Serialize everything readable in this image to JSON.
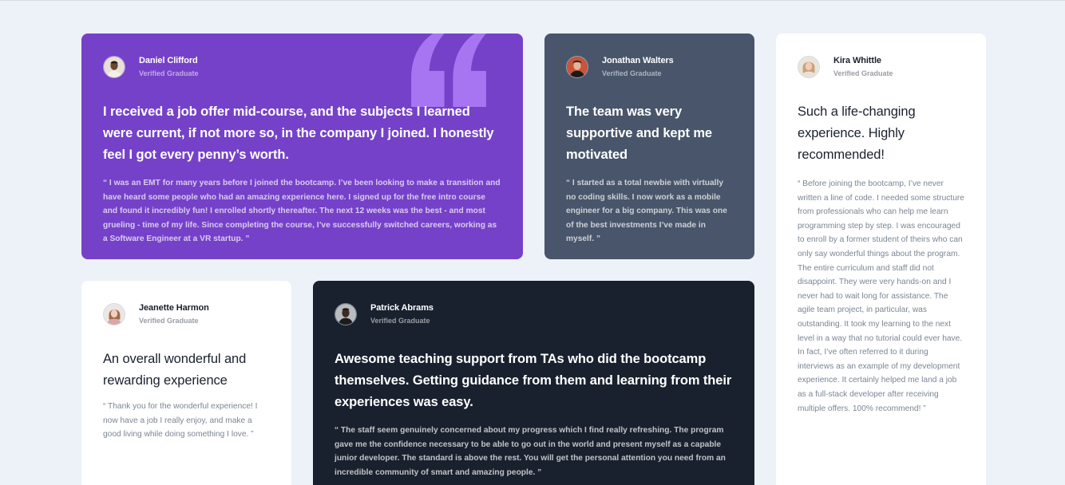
{
  "colors": {
    "page_bg": "#edf1f8",
    "purple": "#7541c8",
    "slate": "#48556a",
    "dark": "#19212e",
    "white": "#ffffff",
    "quote_mark": "#a775f1"
  },
  "testimonials": [
    {
      "name": "Daniel Clifford",
      "role": "Verified Graduate",
      "avatar_icon": "avatar-daniel",
      "headline": "I received a job offer mid-course, and the subjects I learned were current, if not more so, in the company I joined. I honestly feel I got every penny’s worth.",
      "body": "“ I was an EMT for many years before I joined the bootcamp. I’ve been looking to make a transition and have heard some people who had an amazing experience here. I signed up for the free intro course and found it incredibly fun! I enrolled shortly thereafter. The next 12 weeks was the best - and most grueling - time of my life. Since completing the course, I’ve successfully switched careers, working as a Software Engineer at a VR startup. ”",
      "decoration": "quote-icon"
    },
    {
      "name": "Jonathan Walters",
      "role": "Verified Graduate",
      "avatar_icon": "avatar-jonathan",
      "headline": "The team was very supportive and kept me motivated",
      "body": "“ I started as a total newbie with virtually no coding skills. I now work as a mobile engineer for a big company. This was one of the best investments I’ve made in myself. ”"
    },
    {
      "name": "Kira Whittle",
      "role": "Verified Graduate",
      "avatar_icon": "avatar-kira",
      "headline": "Such a life-changing experience. Highly recommended!",
      "body": "“ Before joining the bootcamp, I’ve never written a line of code. I needed some structure from professionals who can help me learn programming step by step. I was encouraged to enroll by a former student of theirs who can only say wonderful things about the program. The entire curriculum and staff did not disappoint. They were very hands-on and I never had to wait long for assistance. The agile team project, in particular, was outstanding. It took my learning to the next level in a way that no tutorial could ever have. In fact, I’ve often referred to it during interviews as an example of my development experience. It certainly helped me land a job as a full-stack developer after receiving multiple offers. 100% recommend! ”"
    },
    {
      "name": "Jeanette Harmon",
      "role": "Verified Graduate",
      "avatar_icon": "avatar-jeanette",
      "headline": "An overall wonderful and rewarding experience",
      "body": "“ Thank you for the wonderful experience! I now have a job I really enjoy, and make a good living while doing something I love. ”"
    },
    {
      "name": "Patrick Abrams",
      "role": "Verified Graduate",
      "avatar_icon": "avatar-patrick",
      "headline": "Awesome teaching support from TAs who did the bootcamp themselves. Getting guidance from them and learning from their experiences was easy.",
      "body": "“ The staff seem genuinely concerned about my progress which I find really refreshing. The program gave me the confidence necessary to be able to go out in the world and present myself as a capable junior developer. The standard is above the rest. You will get the personal attention you need from an incredible community of smart and amazing people. ”"
    }
  ]
}
